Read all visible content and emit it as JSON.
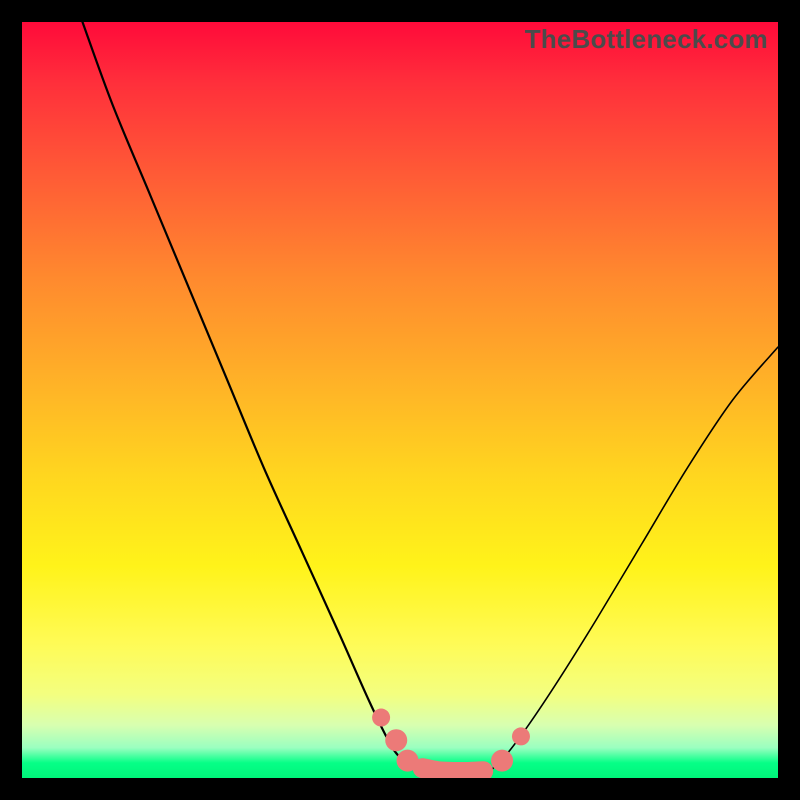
{
  "watermark": "TheBottleneck.com",
  "colors": {
    "background": "#000000",
    "curve": "#000000",
    "marker": "#ec7a78",
    "gradient_top": "#ff0a3a",
    "gradient_bottom": "#00f57a"
  },
  "chart_data": {
    "type": "line",
    "title": "",
    "xlabel": "",
    "ylabel": "",
    "xlim": [
      0,
      100
    ],
    "ylim": [
      0,
      100
    ],
    "series": [
      {
        "name": "left-curve",
        "x": [
          8,
          12,
          17,
          22,
          27,
          32,
          37,
          42,
          46,
          49,
          51,
          53
        ],
        "y": [
          100,
          89,
          77,
          65,
          53,
          41,
          30,
          19,
          10,
          4,
          2,
          1
        ]
      },
      {
        "name": "right-curve",
        "x": [
          62,
          64,
          67,
          71,
          76,
          82,
          88,
          94,
          100
        ],
        "y": [
          1,
          3,
          7,
          13,
          21,
          31,
          41,
          50,
          57
        ]
      },
      {
        "name": "valley-floor",
        "x": [
          53,
          55,
          57,
          59,
          61,
          62
        ],
        "y": [
          1,
          0.6,
          0.5,
          0.5,
          0.7,
          1
        ]
      }
    ],
    "markers": {
      "name": "highlighted-segment",
      "points": [
        {
          "x": 47.5,
          "y": 8
        },
        {
          "x": 49.5,
          "y": 5
        },
        {
          "x": 51,
          "y": 2.3
        },
        {
          "x": 53,
          "y": 1.3
        },
        {
          "x": 55,
          "y": 0.9
        },
        {
          "x": 57,
          "y": 0.8
        },
        {
          "x": 59,
          "y": 0.8
        },
        {
          "x": 61,
          "y": 0.9
        },
        {
          "x": 63.5,
          "y": 2.3
        },
        {
          "x": 66,
          "y": 5.5
        }
      ]
    }
  }
}
